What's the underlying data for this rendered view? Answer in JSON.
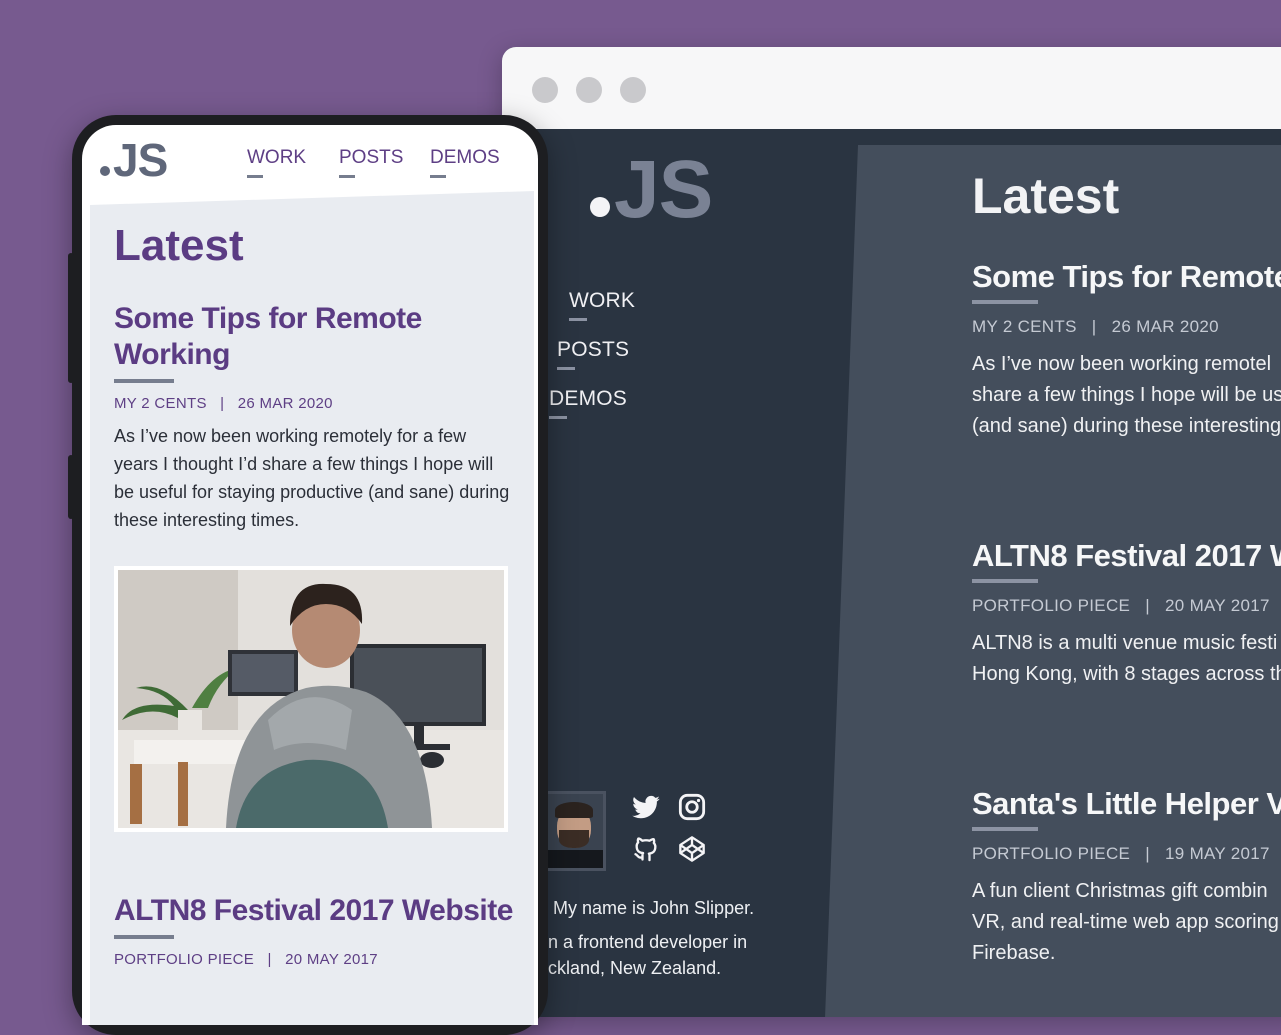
{
  "browser": {
    "window_dots": 3
  },
  "site": {
    "logo": "JS",
    "nav": [
      "WORK",
      "POSTS",
      "DEMOS"
    ],
    "bio_lines": [
      "My name is John Slipper.",
      "n a frontend developer in",
      "ckland, New Zealand."
    ],
    "social_icons": [
      "twitter-icon",
      "instagram-icon",
      "github-icon",
      "codepen-icon"
    ]
  },
  "desktop": {
    "heading": "Latest",
    "posts": [
      {
        "title": "Some Tips for Remote",
        "category": "MY 2 CENTS",
        "date": "26 MAR 2020",
        "excerpt": [
          "As I’ve now been working remotel",
          "share a few things I hope will be us",
          "(and sane) during these interesting"
        ]
      },
      {
        "title": "ALTN8 Festival 2017 W",
        "category": "PORTFOLIO PIECE",
        "date": "20 MAY 2017",
        "excerpt": [
          "ALTN8 is a multi venue music festi",
          "Hong Kong, with 8 stages across th"
        ]
      },
      {
        "title": "Santa's Little Helper V",
        "category": "PORTFOLIO PIECE",
        "date": "19 MAY 2017",
        "excerpt": [
          "A fun client Christmas gift combin",
          "VR, and real-time web app scoring",
          "Firebase."
        ]
      }
    ]
  },
  "mobile": {
    "heading": "Latest",
    "posts": [
      {
        "title": "Some Tips for Remote Working",
        "category": "MY 2 CENTS",
        "date": "26 MAR 2020",
        "excerpt": "As I’ve now been working remotely for a few years I thought I’d share a few things I hope will be useful for staying productive (and sane) during these interesting times."
      },
      {
        "title": "ALTN8 Festival 2017 Website",
        "category": "PORTFOLIO PIECE",
        "date": "20 MAY 2017"
      }
    ]
  },
  "separator": "|"
}
